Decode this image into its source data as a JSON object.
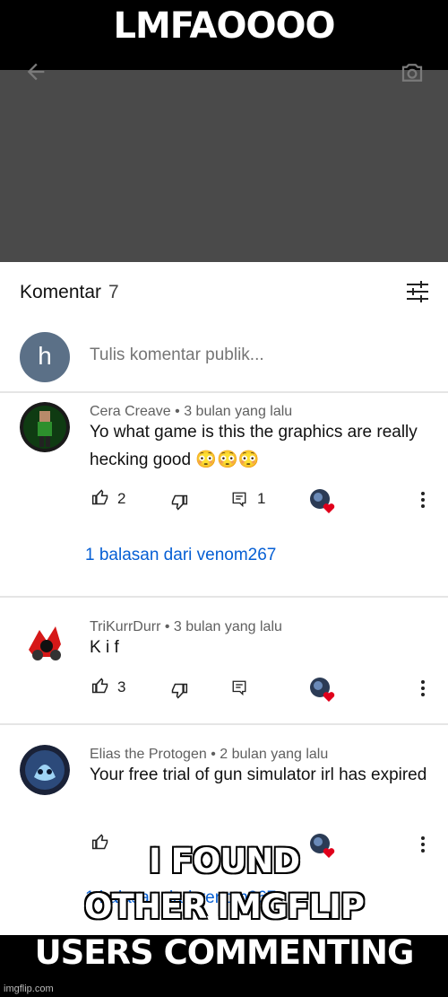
{
  "meme": {
    "top_text": "LMFAOOOO",
    "bottom_lines": [
      "I FOUND",
      "OTHER IMGFLIP",
      "USERS COMMENTING"
    ],
    "watermark": "imgflip.com"
  },
  "comments_header": {
    "title": "Komentar",
    "count": "7"
  },
  "add_comment": {
    "avatar_letter": "h",
    "placeholder": "Tulis komentar publik..."
  },
  "comments": [
    {
      "author": "Cera Creave",
      "time": "3 bulan yang lalu",
      "text": "Yo what game is this the graphics are really hecking good 😳😳😳",
      "likes": "2",
      "replies_count": "1",
      "replies_link": "1 balasan dari venom267"
    },
    {
      "author": "TriKurrDurr",
      "time": "3 bulan yang lalu",
      "text": "K i f",
      "likes": "3"
    },
    {
      "author": "Elias the Protogen",
      "time": "2 bulan yang lalu",
      "text": "Your free trial of gun simulator irl has expired",
      "replies_link": "1 balasan dari venom267"
    }
  ],
  "colors": {
    "link": "#065fd4",
    "heart": "#e0001b",
    "video_bg": "#4a4a4a"
  }
}
